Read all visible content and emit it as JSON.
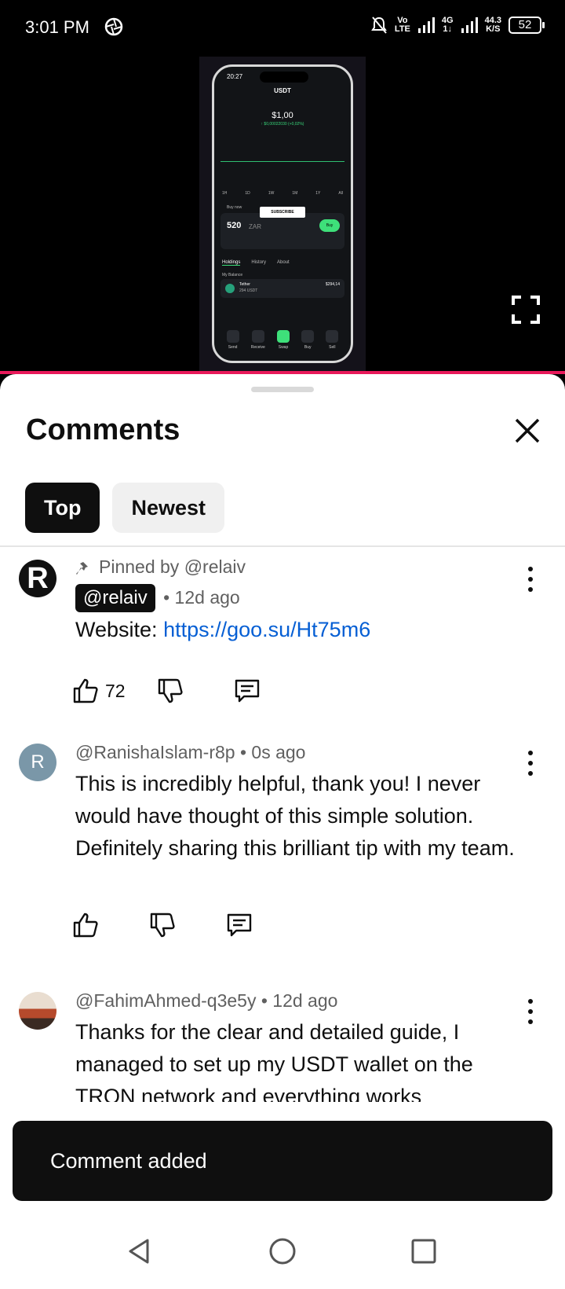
{
  "status_bar": {
    "time": "3:01 PM",
    "net_top": "Vo",
    "net_bottom": "LTE",
    "gen_top": "4G",
    "gen_bottom": "1↓",
    "speed_top": "44.3",
    "speed_bottom": "K/S",
    "battery": "52"
  },
  "video": {
    "phone": {
      "time": "20:27",
      "asset": "USDT",
      "price": "$1,00",
      "change": "↑ $0,00022030 (+0,02%)",
      "ranges": [
        "1H",
        "1D",
        "1W",
        "1M",
        "1Y",
        "All"
      ],
      "buy_label": "Buy now",
      "amount": "520",
      "currency": "ZAR",
      "buy_button": "Buy",
      "subscribe": "SUBSCRIBE",
      "tabs": [
        "Holdings",
        "History",
        "About"
      ],
      "balance_label": "My Balance",
      "token_name": "Tether",
      "token_amount": "294 USDT",
      "token_value": "$294,14",
      "nav": [
        "Send",
        "Receive",
        "Swap",
        "Buy",
        "Sell"
      ]
    }
  },
  "comments_panel": {
    "title": "Comments",
    "tabs": {
      "top": "Top",
      "newest": "Newest"
    },
    "comments": [
      {
        "avatar_letter": "R",
        "pinned_text": "Pinned by @relaiv",
        "author": "@relaiv",
        "time": "• 12d ago",
        "text_prefix": "Website: ",
        "link": "https://goo.su/Ht75m6",
        "likes": "72"
      },
      {
        "avatar_letter": "R",
        "author_meta": "@RanishaIslam-r8p • 0s ago",
        "text": "This is incredibly helpful, thank you! I never would have thought of this simple solution. Definitely sharing this brilliant tip with my team."
      },
      {
        "author_meta": "@FahimAhmed-q3e5y • 12d ago",
        "text": "Thanks for the clear and detailed guide, I managed to set up my USDT wallet on the TRON network and everything works"
      }
    ]
  },
  "toast": {
    "message": "Comment added"
  }
}
